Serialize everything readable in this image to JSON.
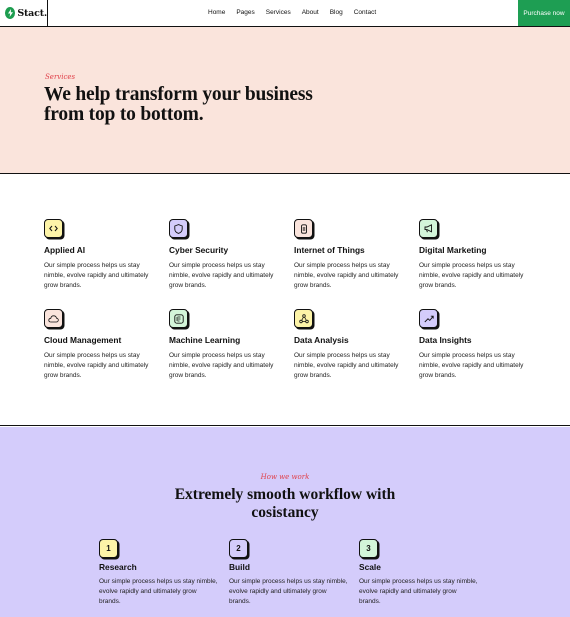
{
  "brand": {
    "name": "Stact."
  },
  "nav": {
    "items": [
      "Home",
      "Pages",
      "Services",
      "About",
      "Blog",
      "Contact"
    ],
    "cta": "Purchase now"
  },
  "hero": {
    "eyebrow": "Services",
    "title": "We help transform your business from top to bottom."
  },
  "services": [
    {
      "title": "Applied AI",
      "desc": "Our simple process helps us stay nimble, evolve rapidly and ultimately grow brands.",
      "icon": "code-icon",
      "color": "#fdf4a8"
    },
    {
      "title": "Cyber Security",
      "desc": "Our simple process helps us stay nimble, evolve rapidly and ultimately grow brands.",
      "icon": "shield-icon",
      "color": "#d4ccfb"
    },
    {
      "title": "Internet of Things",
      "desc": "Our simple process helps us stay nimble, evolve rapidly and ultimately grow brands.",
      "icon": "device-icon",
      "color": "#fae4dc"
    },
    {
      "title": "Digital Marketing",
      "desc": "Our simple process helps us stay nimble, evolve rapidly and ultimately grow brands.",
      "icon": "megaphone-icon",
      "color": "#d3f5d9"
    },
    {
      "title": "Cloud Management",
      "desc": "Our simple process helps us stay nimble, evolve rapidly and ultimately grow brands.",
      "icon": "cloud-icon",
      "color": "#fae4dc"
    },
    {
      "title": "Machine Learning",
      "desc": "Our simple process helps us stay nimble, evolve rapidly and ultimately grow brands.",
      "icon": "machine-icon",
      "color": "#d3f5d9"
    },
    {
      "title": "Data Analysis",
      "desc": "Our simple process helps us stay nimble, evolve rapidly and ultimately grow brands.",
      "icon": "nodes-icon",
      "color": "#fdf4a8"
    },
    {
      "title": "Data Insights",
      "desc": "Our simple process helps us stay nimble, evolve rapidly and ultimately grow brands.",
      "icon": "trend-icon",
      "color": "#d4ccfb"
    }
  ],
  "workflow": {
    "eyebrow": "How we work",
    "title": "Extremely smooth workflow with cosistancy",
    "steps": [
      {
        "num": "1",
        "title": "Research",
        "desc": "Our simple process helps us stay nimble, evolve rapidly and ultimately grow brands.",
        "color": "#fdf4a8"
      },
      {
        "num": "2",
        "title": "Build",
        "desc": "Our simple process helps us stay nimble, evolve rapidly and ultimately grow brands.",
        "color": "#d4ccfb"
      },
      {
        "num": "3",
        "title": "Scale",
        "desc": "Our simple process helps us stay nimble, evolve rapidly and ultimately grow brands.",
        "color": "#d3f5d9"
      }
    ]
  },
  "colors": {
    "accent": "#1e9e53",
    "hero_bg": "#fae4dc",
    "workflow_bg": "#d4ccfb",
    "eyebrow": "#e0424b"
  }
}
